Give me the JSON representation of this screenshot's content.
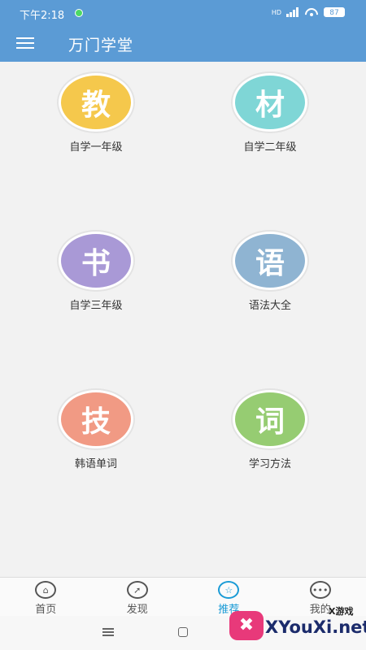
{
  "status_bar": {
    "time": "下午2:18",
    "battery": "87",
    "network": "HD"
  },
  "app_bar": {
    "title": "万门学堂"
  },
  "courses": [
    {
      "glyph": "教",
      "label": "自学一年级",
      "color": "#f5c84c"
    },
    {
      "glyph": "材",
      "label": "自学二年级",
      "color": "#7fd6d6"
    },
    {
      "glyph": "书",
      "label": "自学三年级",
      "color": "#a999d6"
    },
    {
      "glyph": "语",
      "label": "语法大全",
      "color": "#8fb4d2"
    },
    {
      "glyph": "技",
      "label": "韩语单词",
      "color": "#f19a84"
    },
    {
      "glyph": "词",
      "label": "学习方法",
      "color": "#96cc72"
    }
  ],
  "bottom_nav": [
    {
      "label": "首页",
      "icon": "home-icon"
    },
    {
      "label": "发现",
      "icon": "compass-icon"
    },
    {
      "label": "推荐",
      "icon": "star-icon",
      "active": true
    },
    {
      "label": "我的",
      "icon": "more-icon"
    }
  ],
  "watermark": {
    "small": "X游戏",
    "text": "XYouXi.net"
  },
  "colors": {
    "primary": "#5b9bd5",
    "active_tab": "#1a9bd6"
  }
}
